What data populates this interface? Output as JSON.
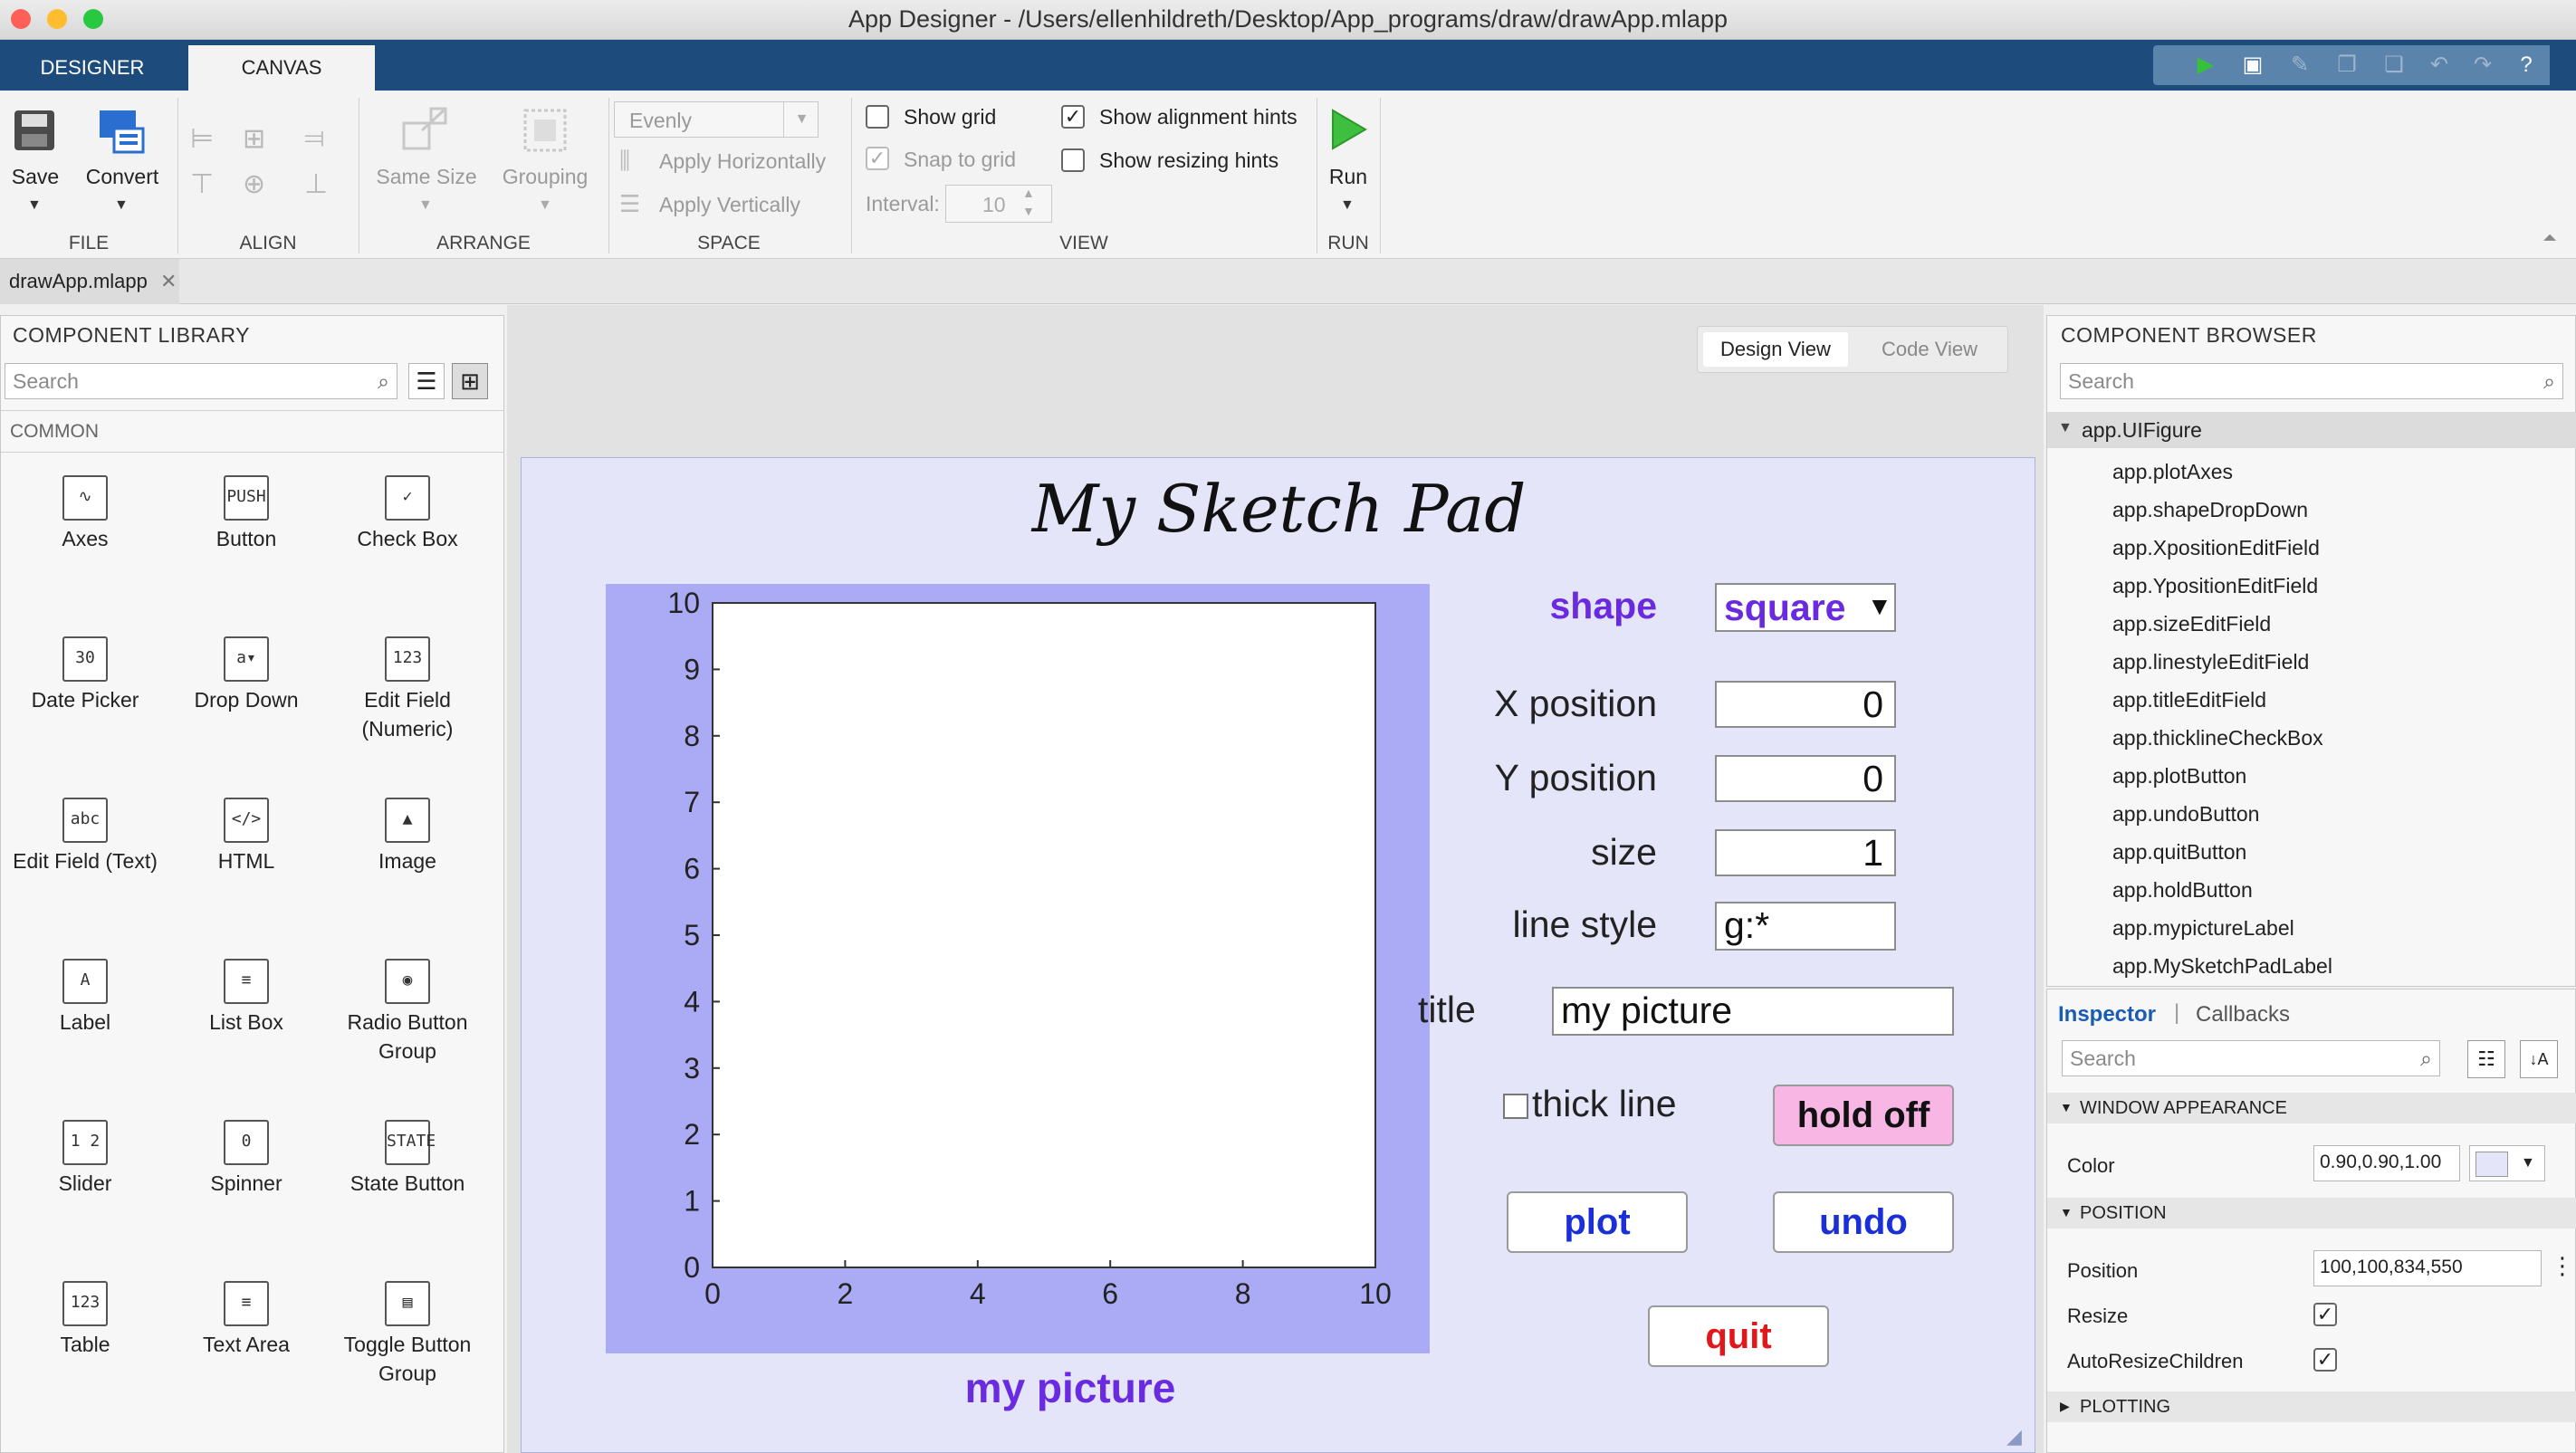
{
  "window": {
    "title": "App Designer - /Users/ellenhildreth/Desktop/App_programs/draw/drawApp.mlapp"
  },
  "tabs": {
    "designer": "DESIGNER",
    "canvas": "CANVAS"
  },
  "ribbon": {
    "file": {
      "label": "FILE",
      "save": "Save",
      "convert": "Convert"
    },
    "align": {
      "label": "ALIGN"
    },
    "arrange": {
      "label": "ARRANGE",
      "same_size": "Same Size",
      "grouping": "Grouping"
    },
    "space": {
      "label": "SPACE",
      "evenly": "Evenly",
      "apply_h": "Apply Horizontally",
      "apply_v": "Apply Vertically",
      "interval_label": "Interval:",
      "interval_value": "10"
    },
    "view": {
      "label": "VIEW",
      "show_grid": "Show grid",
      "snap_to_grid": "Snap to grid",
      "show_alignment_hints": "Show alignment hints",
      "show_resizing_hints": "Show resizing hints"
    },
    "run": {
      "label": "RUN",
      "run": "Run"
    }
  },
  "doc_tab": {
    "name": "drawApp.mlapp"
  },
  "library": {
    "title": "COMPONENT LIBRARY",
    "search_placeholder": "Search",
    "section": "COMMON",
    "items": [
      {
        "label": "Axes",
        "icon": "axes-icon",
        "glyph": "∿"
      },
      {
        "label": "Button",
        "icon": "push-button-icon",
        "glyph": "PUSH"
      },
      {
        "label": "Check Box",
        "icon": "check-box-icon",
        "glyph": "✓"
      },
      {
        "label": "Date Picker",
        "icon": "date-picker-icon",
        "glyph": "30"
      },
      {
        "label": "Drop Down",
        "icon": "drop-down-icon",
        "glyph": "a▾"
      },
      {
        "label": "Edit Field (Numeric)",
        "icon": "numeric-field-icon",
        "glyph": "123"
      },
      {
        "label": "Edit Field (Text)",
        "icon": "text-field-icon",
        "glyph": "abc"
      },
      {
        "label": "HTML",
        "icon": "html-icon",
        "glyph": "</>"
      },
      {
        "label": "Image",
        "icon": "image-icon",
        "glyph": "▲"
      },
      {
        "label": "Label",
        "icon": "label-icon",
        "glyph": "A"
      },
      {
        "label": "List Box",
        "icon": "list-box-icon",
        "glyph": "≡"
      },
      {
        "label": "Radio Button Group",
        "icon": "radio-group-icon",
        "glyph": "◉"
      },
      {
        "label": "Slider",
        "icon": "slider-icon",
        "glyph": "1 2"
      },
      {
        "label": "Spinner",
        "icon": "spinner-icon",
        "glyph": "0"
      },
      {
        "label": "State Button",
        "icon": "state-button-icon",
        "glyph": "STATE"
      },
      {
        "label": "Table",
        "icon": "table-icon",
        "glyph": "123"
      },
      {
        "label": "Text Area",
        "icon": "text-area-icon",
        "glyph": "≡"
      },
      {
        "label": "Toggle Button Group",
        "icon": "toggle-group-icon",
        "glyph": "▤"
      }
    ]
  },
  "view_toggle": {
    "design": "Design View",
    "code": "Code View"
  },
  "app": {
    "title": "My Sketch Pad",
    "shape_label": "shape",
    "shape_value": "square",
    "x_label": "X position",
    "x_value": "0",
    "y_label": "Y position",
    "y_value": "0",
    "size_label": "size",
    "size_value": "1",
    "linestyle_label": "line style",
    "linestyle_value": "g:*",
    "title_label": "title",
    "title_value": "my picture",
    "thick_label": "thick line",
    "hold_label": "hold off",
    "plot_label": "plot",
    "undo_label": "undo",
    "quit_label": "quit",
    "picture_label": "my picture",
    "axes": {
      "x_ticks": [
        "0",
        "2",
        "4",
        "6",
        "8",
        "10"
      ],
      "y_ticks": [
        "0",
        "1",
        "2",
        "3",
        "4",
        "5",
        "6",
        "7",
        "8",
        "9",
        "10"
      ]
    }
  },
  "browser": {
    "title": "COMPONENT BROWSER",
    "search_placeholder": "Search",
    "root": "app.UIFigure",
    "items": [
      "app.plotAxes",
      "app.shapeDropDown",
      "app.XpositionEditField",
      "app.YpositionEditField",
      "app.sizeEditField",
      "app.linestyleEditField",
      "app.titleEditField",
      "app.thicklineCheckBox",
      "app.plotButton",
      "app.undoButton",
      "app.quitButton",
      "app.holdButton",
      "app.mypictureLabel",
      "app.MySketchPadLabel"
    ]
  },
  "inspector": {
    "tab_inspector": "Inspector",
    "tab_callbacks": "Callbacks",
    "search_placeholder": "Search",
    "window_appearance": "WINDOW APPEARANCE",
    "color_label": "Color",
    "color_value": "0.90,0.90,1.00",
    "position_section": "POSITION",
    "position_label": "Position",
    "position_value": "100,100,834,550",
    "resize_label": "Resize",
    "autoresize_label": "AutoResizeChildren",
    "plotting_section": "PLOTTING"
  },
  "colors": {
    "figure_bg": "#e5e5fa",
    "axes_bg": "#aaaaf5",
    "purple_text": "#6a2be0",
    "blue_text": "#1a2fd6",
    "red_text": "#e0181c",
    "hold_bg": "#f7b6e4",
    "toolstrip_blue": "#1d4c7c"
  }
}
